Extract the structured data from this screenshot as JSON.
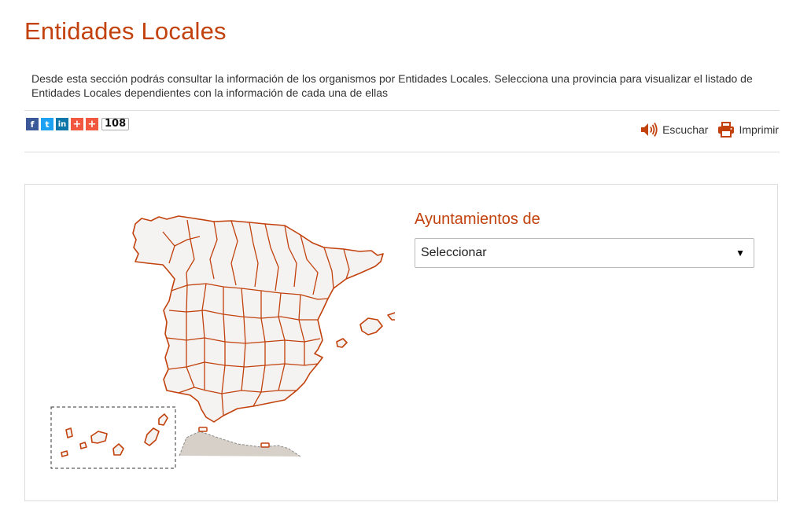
{
  "header": {
    "title": "Entidades Locales",
    "description": "Desde esta sección podrás consultar la información de los organismos por Entidades Locales. Selecciona una provincia para visualizar el listado de Entidades Locales dependientes con la información de cada una de ellas"
  },
  "share": {
    "buttons": [
      {
        "icon": "facebook-icon",
        "glyph": "f"
      },
      {
        "icon": "twitter-icon",
        "glyph": "t"
      },
      {
        "icon": "linkedin-icon",
        "glyph": "in"
      },
      {
        "icon": "plus-icon",
        "glyph": "+"
      },
      {
        "icon": "plus-icon",
        "glyph": "+"
      }
    ],
    "count": "108"
  },
  "tools": {
    "listen_label": "Escuchar",
    "print_label": "Imprimir"
  },
  "map": {
    "province_fill": "#f4f3f2",
    "province_stroke": "#c2410c",
    "africa_fill": "#d6d0c8"
  },
  "selector": {
    "label": "Ayuntamientos de",
    "selected": "Seleccionar"
  },
  "colors": {
    "accent": "#c2410c",
    "text": "#333333",
    "border": "#dddddd"
  }
}
